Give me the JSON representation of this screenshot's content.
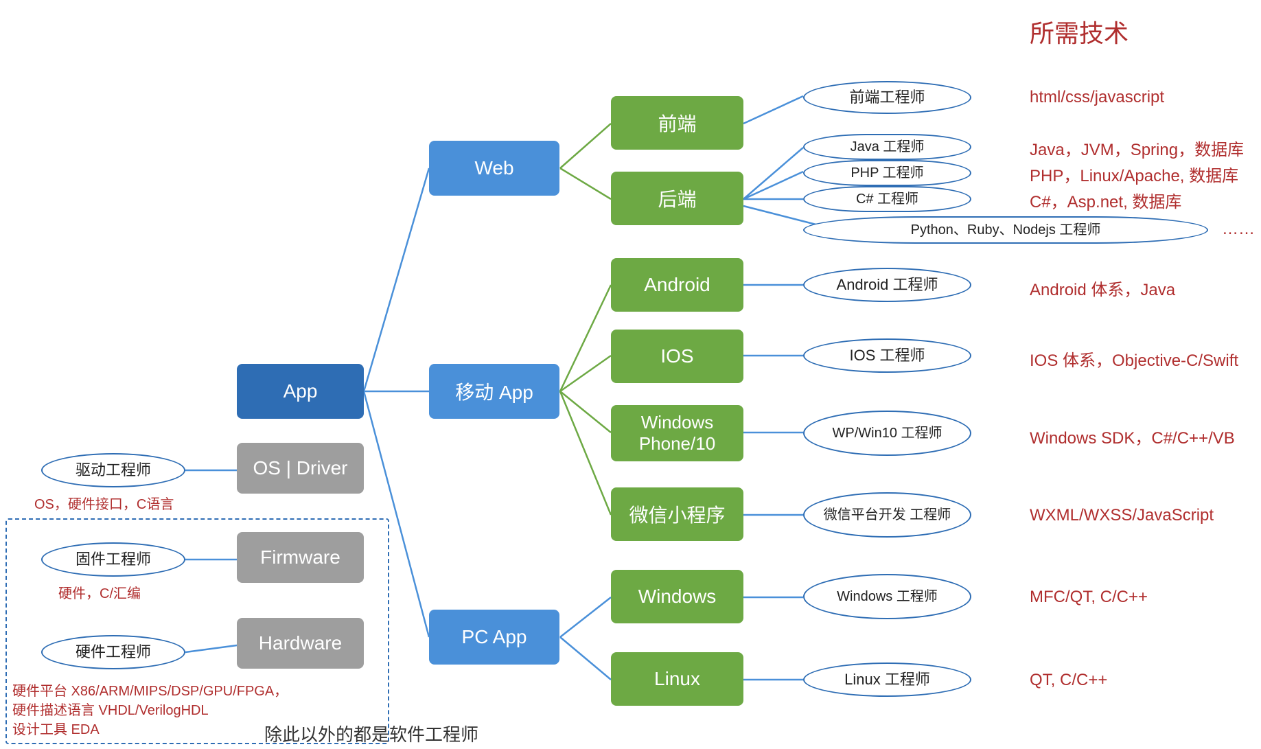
{
  "title": "所需技术",
  "footer_note": "除此以外的都是软件工程师",
  "root": {
    "app": "App",
    "os_driver": "OS | Driver",
    "firmware": "Firmware",
    "hardware": "Hardware"
  },
  "left_roles": {
    "driver_engineer": "驱动工程师",
    "driver_tech": "OS，硬件接口，C语言",
    "firmware_engineer": "固件工程师",
    "firmware_tech": "硬件，C/汇编",
    "hardware_engineer": "硬件工程师",
    "hardware_tech_l1": "硬件平台 X86/ARM/MIPS/DSP/GPU/FPGA，",
    "hardware_tech_l2": "硬件描述语言 VHDL/VerilogHDL",
    "hardware_tech_l3": "设计工具 EDA"
  },
  "mid": {
    "web": "Web",
    "mobile": "移动 App",
    "pc": "PC App"
  },
  "leaf": {
    "frontend": "前端",
    "backend": "后端",
    "android": "Android",
    "ios": "IOS",
    "wp": "Windows Phone/10",
    "wechat": "微信小程序",
    "windows": "Windows",
    "linux": "Linux"
  },
  "roles": {
    "frontend": "前端工程师",
    "java": "Java 工程师",
    "php": "PHP 工程师",
    "csharp": "C# 工程师",
    "pyrubynode": "Python、Ruby、Nodejs 工程师",
    "android": "Android 工程师",
    "ios": "IOS 工程师",
    "wp": "WP/Win10 工程师",
    "wechat": "微信平台开发 工程师",
    "windows": "Windows 工程师",
    "linux": "Linux 工程师"
  },
  "techs": {
    "frontend": "html/css/javascript",
    "java": "Java，JVM，Spring，数据库",
    "php": "PHP，Linux/Apache, 数据库",
    "csharp": "C#，Asp.net, 数据库",
    "pyrubynode": "……",
    "android": "Android 体系，Java",
    "ios": "IOS 体系，Objective-C/Swift",
    "wp": "Windows SDK，C#/C++/VB",
    "wechat": "WXML/WXSS/JavaScript",
    "windows": "MFC/QT, C/C++",
    "linux": "QT, C/C++"
  },
  "chart_data": {
    "type": "tree",
    "title": "所需技术",
    "root": "App",
    "siblings_of_root": [
      "OS | Driver",
      "Firmware",
      "Hardware"
    ],
    "children": {
      "App": [
        "Web",
        "移动 App",
        "PC App"
      ],
      "Web": [
        "前端",
        "后端"
      ],
      "移动 App": [
        "Android",
        "IOS",
        "Windows Phone/10",
        "微信小程序"
      ],
      "PC App": [
        "Windows",
        "Linux"
      ]
    },
    "role_map": {
      "前端": [
        {
          "role": "前端工程师",
          "tech": "html/css/javascript"
        }
      ],
      "后端": [
        {
          "role": "Java 工程师",
          "tech": "Java，JVM，Spring，数据库"
        },
        {
          "role": "PHP 工程师",
          "tech": "PHP，Linux/Apache, 数据库"
        },
        {
          "role": "C# 工程师",
          "tech": "C#，Asp.net, 数据库"
        },
        {
          "role": "Python、Ruby、Nodejs 工程师",
          "tech": "……"
        }
      ],
      "Android": [
        {
          "role": "Android 工程师",
          "tech": "Android 体系，Java"
        }
      ],
      "IOS": [
        {
          "role": "IOS 工程师",
          "tech": "IOS 体系，Objective-C/Swift"
        }
      ],
      "Windows Phone/10": [
        {
          "role": "WP/Win10 工程师",
          "tech": "Windows SDK，C#/C++/VB"
        }
      ],
      "微信小程序": [
        {
          "role": "微信平台开发 工程师",
          "tech": "WXML/WXSS/JavaScript"
        }
      ],
      "Windows": [
        {
          "role": "Windows 工程师",
          "tech": "MFC/QT, C/C++"
        }
      ],
      "Linux": [
        {
          "role": "Linux 工程师",
          "tech": "QT, C/C++"
        }
      ],
      "OS | Driver": [
        {
          "role": "驱动工程师",
          "tech": "OS，硬件接口，C语言"
        }
      ],
      "Firmware": [
        {
          "role": "固件工程师",
          "tech": "硬件，C/汇编"
        }
      ],
      "Hardware": [
        {
          "role": "硬件工程师",
          "tech": "硬件平台 X86/ARM/MIPS/DSP/GPU/FPGA，硬件描述语言 VHDL/VerilogHDL，设计工具 EDA"
        }
      ]
    },
    "footer": "除此以外的都是软件工程师"
  }
}
